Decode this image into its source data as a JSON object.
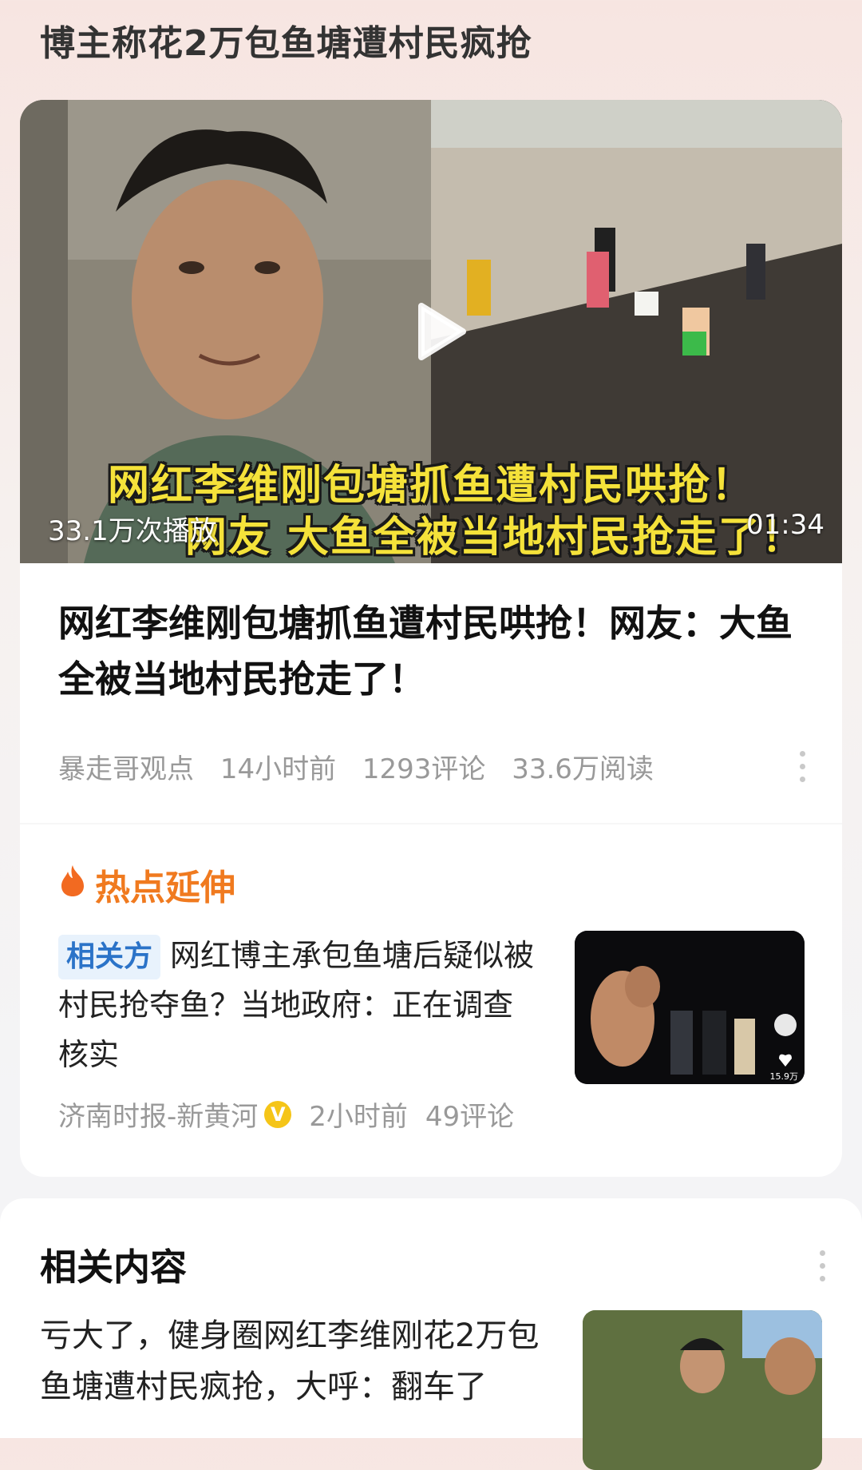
{
  "headline": "博主称花2万包鱼塘遭村民疯抢",
  "video": {
    "caption_line1": "网红李维刚包塘抓鱼遭村民哄抢！",
    "caption_line2": "网友 大鱼全被当地村民抢走了！",
    "play_count": "33.1万次播放",
    "duration": "01:34",
    "icon": "play-icon"
  },
  "article": {
    "title": "网红李维刚包塘抓鱼遭村民哄抢！网友：大鱼全被当地村民抢走了！",
    "source": "暴走哥观点",
    "time": "14小时前",
    "comments": "1293评论",
    "reads": "33.6万阅读"
  },
  "hot": {
    "header": "热点延伸",
    "icon": "flame-icon",
    "item": {
      "badge": "相关方",
      "title": "网红博主承包鱼塘后疑似被村民抢夺鱼？当地政府：正在调查核实",
      "source": "济南时报-新黄河",
      "verified_mark": "V",
      "time": "2小时前",
      "comments": "49评论",
      "thumb_like_count": "15.9万"
    }
  },
  "related": {
    "title": "相关内容",
    "item_title": "亏大了，健身圈网红李维刚花2万包鱼塘遭村民疯抢，大呼：翻车了"
  },
  "colors": {
    "accent_orange": "#f07a1f",
    "badge_blue": "#2b73c8",
    "caption_yellow": "#f5e23a"
  }
}
